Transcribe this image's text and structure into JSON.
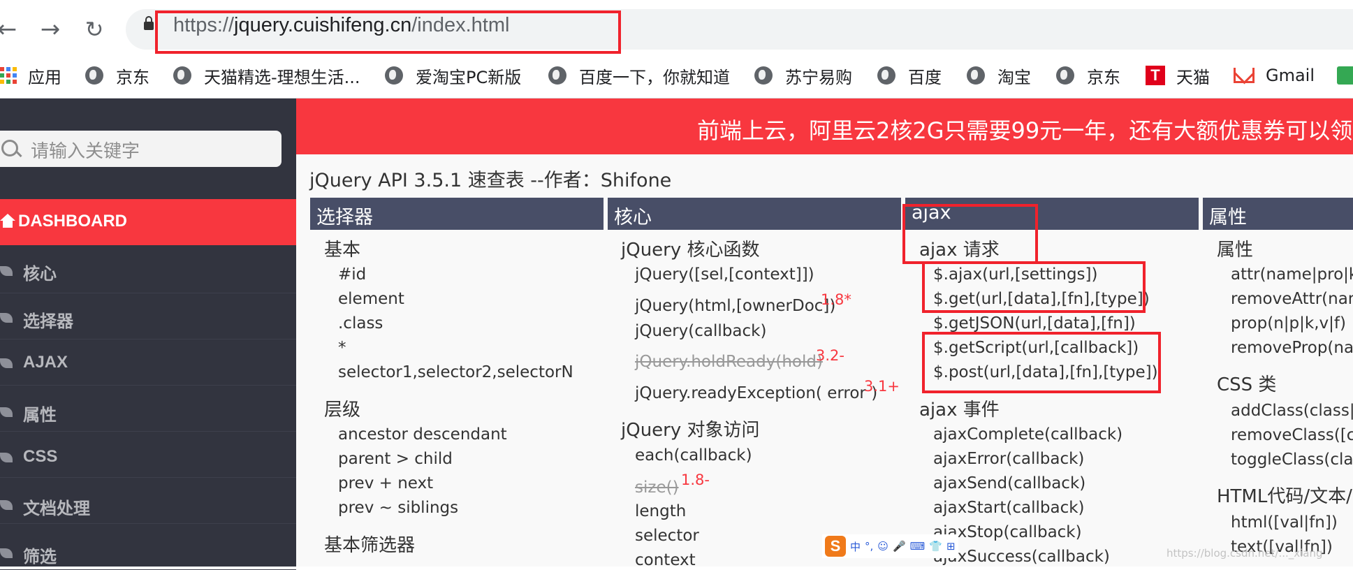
{
  "browser": {
    "back_icon": "back-arrow",
    "forward_icon": "forward-arrow",
    "reload_icon": "reload",
    "url_scheme": "https://",
    "url_host": "jquery.cuishifeng.cn",
    "url_path": "/index.html",
    "bookmarks": [
      "应用",
      "京东",
      "天猫精选-理想生活...",
      "爱淘宝PC新版",
      "百度一下，你就知道",
      "苏宁易购",
      "百度",
      "淘宝",
      "京东",
      "天猫",
      "Gmail"
    ],
    "tmall_glyph": "T"
  },
  "sidebar": {
    "search_placeholder": "请输入关键字",
    "active_item": "DASHBOARD",
    "items": [
      "核心",
      "选择器",
      "AJAX",
      "属性",
      "CSS",
      "文档处理",
      "筛选"
    ]
  },
  "banner": {
    "text": "前端上云，阿里云2核2G只需要99元一年，还有大额优惠券可以领，"
  },
  "page": {
    "title": "jQuery API 3.5.1 速查表  --作者：Shifone"
  },
  "columns": {
    "selector": {
      "header": "选择器",
      "basic": "基本",
      "basic_items": [
        "#id",
        "element",
        ".class",
        "*",
        "selector1,selector2,selectorN"
      ],
      "hierarchy": "层级",
      "hierarchy_items": [
        "ancestor descendant",
        "parent > child",
        "prev + next",
        "prev ~ siblings"
      ],
      "basic_filter": "基本筛选器"
    },
    "core": {
      "header": "核心",
      "core_func": "jQuery 核心函数",
      "f1": "jQuery([sel,[context]])",
      "f2": "jQuery(html,[ownerDoc])",
      "f2_ver": "1.8*",
      "f3": "jQuery(callback)",
      "f4": "jQuery.holdReady(hold)",
      "f4_ver": "3.2-",
      "f5": "jQuery.readyException( error )",
      "f5_ver": "3.1+",
      "obj_access": "jQuery 对象访问",
      "o1": "each(callback)",
      "o2": "size()",
      "o2_ver": "1.8-",
      "o3": "length",
      "o4": "selector",
      "o5": "context"
    },
    "ajax": {
      "header": "ajax",
      "request": "ajax 请求",
      "r1": "$.ajax(url,[settings])",
      "r2": "$.get(url,[data],[fn],[type])",
      "r3": "$.getJSON(url,[data],[fn])",
      "r4": "$.getScript(url,[callback])",
      "r5": "$.post(url,[data],[fn],[type])",
      "events": "ajax 事件",
      "e1": "ajaxComplete(callback)",
      "e2": "ajaxError(callback)",
      "e3": "ajaxSend(callback)",
      "e4": "ajaxStart(callback)",
      "e5": "ajaxStop(callback)",
      "e6": "ajaxSuccess(callback)"
    },
    "attr": {
      "header": "属性",
      "attrs": "属性",
      "a1": "attr(name|pro|ke",
      "a2": "removeAttr(name",
      "a3": "prop(n|p|k,v|f)",
      "a4": "removeProp(nam",
      "css_class": "CSS 类",
      "c1": "addClass(class|f",
      "c2": "removeClass([cla",
      "c3": "toggleClass(clas",
      "html_text": "HTML代码/文本/",
      "h1": "html([val|fn])",
      "h2": "text([val|fn])"
    }
  },
  "ime": {
    "logo": "S",
    "items": [
      "中",
      "°,",
      "☺",
      "🎤",
      "⌨",
      "👕",
      "⊞"
    ]
  },
  "watermark": "https://blog.csdn.net/..._xiang"
}
